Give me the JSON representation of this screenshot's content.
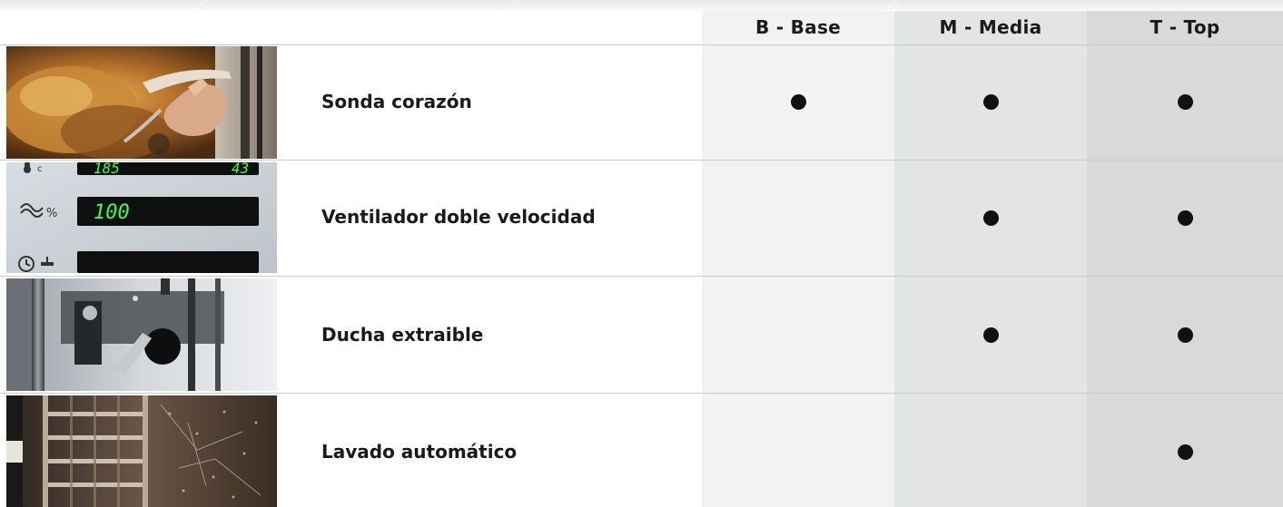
{
  "columns": {
    "base": "B - Base",
    "media": "M - Media",
    "top": "T - Top"
  },
  "features": [
    {
      "label": "Sonda corazón",
      "image": "core-probe-photo",
      "base": true,
      "media": true,
      "top": true
    },
    {
      "label": "Ventilador doble velocidad",
      "image": "control-panel-photo",
      "base": false,
      "media": true,
      "top": true
    },
    {
      "label": "Ducha extraible",
      "image": "retractable-shower-photo",
      "base": false,
      "media": true,
      "top": true
    },
    {
      "label": "Lavado automático",
      "image": "oven-washing-photo",
      "base": false,
      "media": false,
      "top": true
    }
  ],
  "panel_readouts": {
    "temperature": "185",
    "temperature_right": "43",
    "fan_percent": "100"
  },
  "colors": {
    "base_column": "#f1f2f1",
    "media_column": "#e3e4e5",
    "top_column": "#d8d9db",
    "dot": "#111111",
    "led": "#3cff4c"
  }
}
